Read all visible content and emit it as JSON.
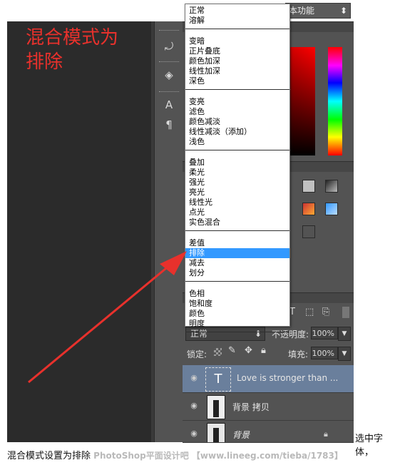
{
  "workspace": {
    "label": "本功能"
  },
  "annotation": {
    "line1": "混合模式为",
    "line2": "排除"
  },
  "tools": [
    "5",
    "A",
    "¶"
  ],
  "blend_menu": {
    "groups": [
      [
        "正常",
        "溶解"
      ],
      [
        "变暗",
        "正片叠底",
        "颜色加深",
        "线性加深",
        "深色"
      ],
      [
        "变亮",
        "滤色",
        "颜色减淡",
        "线性减淡（添加）",
        "浅色"
      ],
      [
        "叠加",
        "柔光",
        "强光",
        "亮光",
        "线性光",
        "点光",
        "实色混合"
      ],
      [
        "差值",
        "排除",
        "减去",
        "划分"
      ],
      [
        "色相",
        "饱和度",
        "颜色",
        "明度"
      ]
    ],
    "selected": "排除"
  },
  "layers_panel": {
    "blend_mode": "正常",
    "opacity_label": "不透明度:",
    "opacity_value": "100%",
    "lock_label": "锁定:",
    "fill_label": "填充:",
    "fill_value": "100%",
    "layers": [
      {
        "name": "Love is stronger    than ...",
        "thumb": "T",
        "selected": true
      },
      {
        "name": "背景 拷贝",
        "thumb": "",
        "selected": false
      },
      {
        "name": "背景",
        "thumb": "",
        "selected": false
      }
    ]
  },
  "caption": {
    "tail": "选中字体，",
    "main": "混合模式设置为排除",
    "watermark": "PhotoShop平面设计吧 【www.lineeg.com/tieba/1783】"
  },
  "colors": {
    "arrow": "#e8312c",
    "selection": "#3399ff"
  }
}
